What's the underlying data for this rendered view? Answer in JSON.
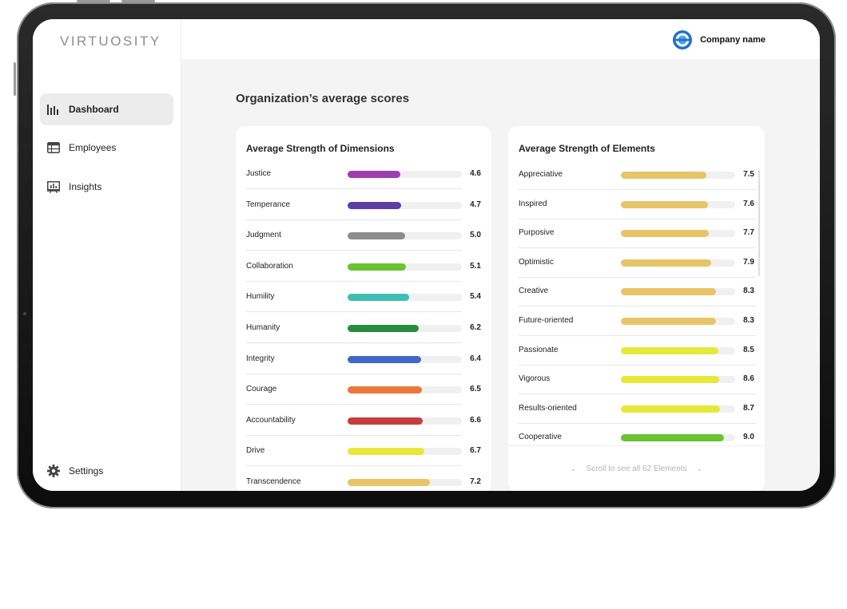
{
  "brand": {
    "logo_text": "VIRTUOSITY"
  },
  "header": {
    "company_name": "Company name"
  },
  "sidebar": {
    "items": [
      {
        "label": "Dashboard",
        "icon": "bar-chart-icon"
      },
      {
        "label": "Employees",
        "icon": "table-icon"
      },
      {
        "label": "Insights",
        "icon": "presentation-icon"
      }
    ],
    "settings_label": "Settings"
  },
  "main": {
    "title": "Organization’s average scores"
  },
  "dimensions": {
    "title": "Average Strength of Dimensions",
    "max": 10,
    "items": [
      {
        "label": "Justice",
        "value": "4.6",
        "color": "#9b3fb0"
      },
      {
        "label": "Temperance",
        "value": "4.7",
        "color": "#5b3fa6"
      },
      {
        "label": "Judgment",
        "value": "5.0",
        "color": "#8c8c8c"
      },
      {
        "label": "Collaboration",
        "value": "5.1",
        "color": "#6bc232"
      },
      {
        "label": "Humility",
        "value": "5.4",
        "color": "#3dbfb2"
      },
      {
        "label": "Humanity",
        "value": "6.2",
        "color": "#2a8a3e"
      },
      {
        "label": "Integrity",
        "value": "6.4",
        "color": "#4466c6"
      },
      {
        "label": "Courage",
        "value": "6.5",
        "color": "#e8793a"
      },
      {
        "label": "Accountability",
        "value": "6.6",
        "color": "#c63d3d"
      },
      {
        "label": "Drive",
        "value": "6.7",
        "color": "#e6e83a"
      },
      {
        "label": "Transcendence",
        "value": "7.2",
        "color": "#e8c468"
      }
    ]
  },
  "elements": {
    "title": "Average Strength of Elements",
    "max": 10,
    "items": [
      {
        "label": "Appreciative",
        "value": "7.5",
        "color": "#e8c468"
      },
      {
        "label": "Inspired",
        "value": "7.6",
        "color": "#e8c468"
      },
      {
        "label": "Purposive",
        "value": "7.7",
        "color": "#e8c468"
      },
      {
        "label": "Optimistic",
        "value": "7.9",
        "color": "#e8c468"
      },
      {
        "label": "Creative",
        "value": "8.3",
        "color": "#e8c468"
      },
      {
        "label": "Future-oriented",
        "value": "8.3",
        "color": "#e8c468"
      },
      {
        "label": "Passionate",
        "value": "8.5",
        "color": "#e6e83a"
      },
      {
        "label": "Vigorous",
        "value": "8.6",
        "color": "#e6e83a"
      },
      {
        "label": "Results-oriented",
        "value": "8.7",
        "color": "#e6e83a"
      },
      {
        "label": "Cooperative",
        "value": "9.0",
        "color": "#6bc232"
      }
    ],
    "footer_text": "Scroll to see all 62 Elements"
  }
}
